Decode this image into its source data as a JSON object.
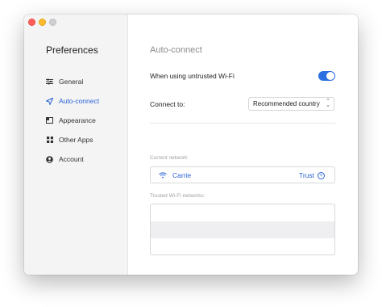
{
  "sidebar": {
    "title": "Preferences",
    "items": [
      {
        "label": "General",
        "icon": "sliders-icon",
        "active": false
      },
      {
        "label": "Auto-connect",
        "icon": "send-icon",
        "active": true
      },
      {
        "label": "Appearance",
        "icon": "window-icon",
        "active": false
      },
      {
        "label": "Other Apps",
        "icon": "grid-icon",
        "active": false
      },
      {
        "label": "Account",
        "icon": "user-icon",
        "active": false
      }
    ]
  },
  "content": {
    "title": "Auto-connect",
    "untrusted_wifi_label": "When using untrusted Wi-Fi",
    "untrusted_wifi_enabled": true,
    "connect_to_label": "Connect to:",
    "connect_to_value": "Recommended country",
    "current_network_label": "Current network:",
    "current_network_name": "Carrie",
    "trust_label": "Trust",
    "trusted_networks_label": "Trusted Wi-Fi networks:"
  },
  "colors": {
    "accent": "#2b6fe0",
    "link": "#2b63d6"
  }
}
